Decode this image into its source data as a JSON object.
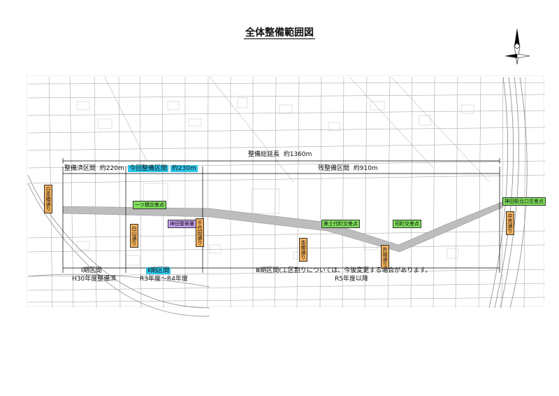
{
  "title": "全体整備範囲図",
  "total": {
    "label": "整備総延長",
    "value": "約1360m"
  },
  "done": {
    "label": "整備済区間",
    "value": "約220m"
  },
  "current": {
    "label": "今回整備区間",
    "value": "約230m"
  },
  "remain": {
    "label": "残整備区間",
    "value": "約910m"
  },
  "phase1": {
    "name": "Ⅰ期区間",
    "year": "H30年度整備済"
  },
  "phase2": {
    "name": "Ⅱ期区間",
    "year": "R3年度～R4年度"
  },
  "phase3": {
    "name": "Ⅲ期区間(工区割りについては、今後変更する場合があります。",
    "year": "R5年度以降"
  },
  "green_labels": [
    "一ツ橋交差点",
    "美土代町交差点",
    "司町交差点",
    "神田駅北口交差点"
  ],
  "purple_labels": [
    "神田警察署"
  ],
  "street_labels": [
    "白山通り",
    "千代田通り",
    "本郷通り",
    "外堀通り",
    "中央通り",
    "日本橋通り"
  ],
  "colors": {
    "green": "#7fe05a",
    "purple": "#c89ef0",
    "orange": "#f2b05a",
    "cyan": "#2ec8ec",
    "road": "#bdbdbd"
  },
  "icons": [
    "north-arrow-icon"
  ]
}
